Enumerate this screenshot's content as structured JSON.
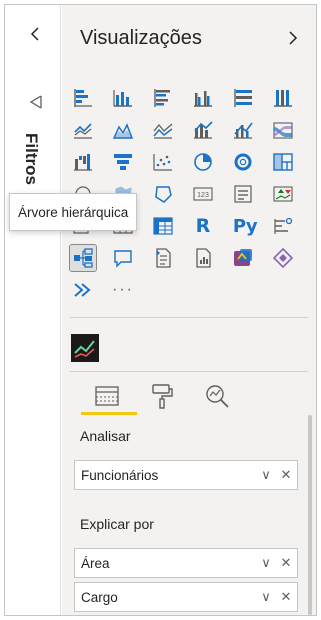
{
  "filters_pane": {
    "label": "Filtros",
    "collapse_icon": "chevron-left-icon",
    "pane_icon": "filter-pane-icon"
  },
  "visualizations": {
    "title": "Visualizações",
    "expand_icon": "chevron-right-icon",
    "gallery": [
      "stacked-bar-chart-icon",
      "stacked-column-chart-icon",
      "clustered-bar-chart-icon",
      "clustered-column-chart-icon",
      "100-stacked-bar-chart-icon",
      "100-stacked-column-chart-icon",
      "line-chart-icon",
      "area-chart-icon",
      "stacked-area-chart-icon",
      "line-and-stacked-column-chart-icon",
      "line-and-clustered-column-chart-icon",
      "ribbon-chart-icon",
      "waterfall-chart-icon",
      "funnel-chart-icon",
      "scatter-chart-icon",
      "pie-chart-icon",
      "donut-chart-icon",
      "treemap-icon",
      "map-icon",
      "filled-map-icon",
      "shape-map-icon",
      "card-icon",
      "multi-row-card-icon",
      "kpi-icon",
      "slicer-icon",
      "table-icon",
      "matrix-icon",
      "r-visual-icon",
      "python-visual-icon",
      "key-influencers-icon",
      "decomposition-tree-icon",
      "qna-icon",
      "smart-narrative-icon",
      "paginated-report-icon",
      "power-apps-icon",
      "power-automate-icon",
      "azure-map-icon",
      "more-visuals-icon"
    ],
    "r_label": "R",
    "py_label": "Py",
    "card_value": "123",
    "more_label": "···",
    "custom_visual_icon": "custom-sparkline-icon",
    "tooltip": "Árvore hierárquica"
  },
  "tabs": {
    "fields_icon": "build-visual-fields-icon",
    "format_icon": "format-paint-roller-icon",
    "analytics_icon": "analytics-magnifier-icon"
  },
  "wells": {
    "analyze_label": "Analisar",
    "analyze_fields": [
      "Funcionários"
    ],
    "explain_label": "Explicar por",
    "explain_fields": [
      "Área",
      "Cargo"
    ],
    "dropdown_glyph": "∨",
    "remove_glyph": "✕"
  },
  "colors": {
    "accent_yellow": "#f2c811",
    "icon_blue": "#1a73c8",
    "pane_bg": "#f3f2f1",
    "active_tile": "#e1dfdd"
  }
}
